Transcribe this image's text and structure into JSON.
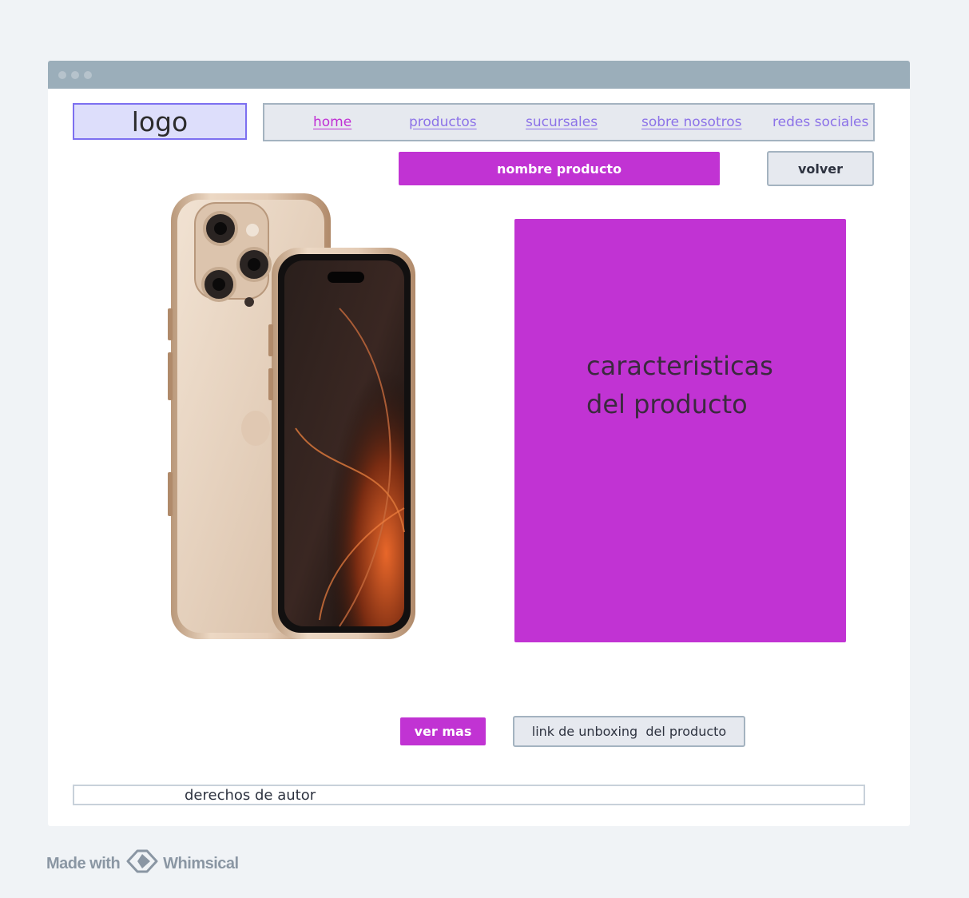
{
  "window": {
    "title_dots": 3
  },
  "header": {
    "logo_label": "logo",
    "nav": [
      {
        "label": "home",
        "active": true
      },
      {
        "label": "productos",
        "active": false
      },
      {
        "label": "sucursales",
        "active": false
      },
      {
        "label": "sobre nosotros",
        "active": false
      },
      {
        "label": "redes sociales",
        "active": false
      }
    ]
  },
  "product": {
    "name_label": "nombre producto",
    "back_label": "volver",
    "image_icon": "phone-image",
    "features_line1": "caracteristicas",
    "features_line2": "del producto"
  },
  "actions": {
    "more_label": "ver mas",
    "unboxing_label": "link de unboxing  del producto"
  },
  "footer": {
    "copyright_label": "derechos de autor"
  },
  "watermark": {
    "made_with": "Made with",
    "brand": "Whimsical"
  },
  "colors": {
    "accent": "#c133d3",
    "nav_link": "#8c72e8",
    "nav_active": "#c02fd4",
    "logo_border": "#7c6ff0",
    "titlebar": "#9baeba"
  }
}
